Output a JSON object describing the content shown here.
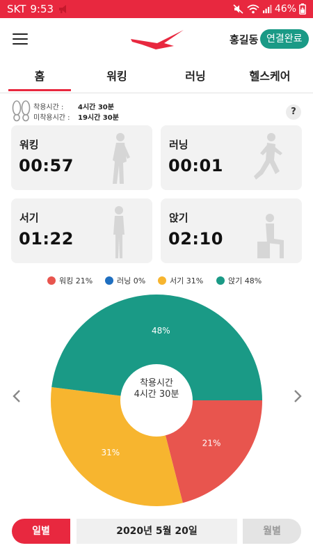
{
  "status_bar": {
    "carrier": "SKT",
    "time": "9:53",
    "battery": "46%",
    "icons": [
      "notification-icon",
      "mute-icon",
      "wifi-icon",
      "signal-icon",
      "battery-icon"
    ]
  },
  "header": {
    "menu_icon": "hamburger-menu-icon",
    "logo": "brand-logo",
    "user_name": "홍길동",
    "connection_status": "연결완료"
  },
  "tabs": [
    {
      "label": "홈",
      "active": true
    },
    {
      "label": "워킹",
      "active": false
    },
    {
      "label": "러닝",
      "active": false
    },
    {
      "label": "헬스케어",
      "active": false
    }
  ],
  "wear_info": {
    "worn_label": "착용시간 :",
    "worn_value": "4시간 30분",
    "unworn_label": "미착용시간 :",
    "unworn_value": "19시간 30분",
    "help": "?"
  },
  "cards": [
    {
      "label": "워킹",
      "value": "00:57",
      "icon": "walking-person-icon"
    },
    {
      "label": "러닝",
      "value": "00:01",
      "icon": "running-person-icon"
    },
    {
      "label": "서기",
      "value": "01:22",
      "icon": "standing-person-icon"
    },
    {
      "label": "앉기",
      "value": "02:10",
      "icon": "sitting-person-icon"
    }
  ],
  "chart_data": {
    "type": "pie",
    "categories": [
      "워킹",
      "러닝",
      "서기",
      "앉기"
    ],
    "values": [
      21,
      0,
      31,
      48
    ],
    "legend": [
      "워킹 21%",
      "러닝 0%",
      "서기 31%",
      "앉기 48%"
    ],
    "slice_labels": [
      "21%",
      "0%",
      "31%",
      "48%"
    ],
    "colors": [
      "#e8554e",
      "#1f6fc0",
      "#f7b52f",
      "#1a9a86"
    ],
    "center_line1": "착용시간",
    "center_line2": "4시간 30분",
    "legend_position": "top"
  },
  "footer": {
    "daily": "일별",
    "date": "2020년 5월 20일",
    "monthly": "월별"
  },
  "colors": {
    "accent": "#e8283f",
    "teal": "#1a9a86",
    "card_bg": "#f2f2f2"
  }
}
